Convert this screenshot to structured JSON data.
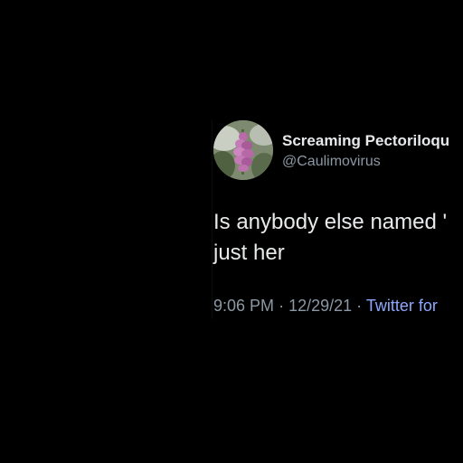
{
  "tweet": {
    "display_name": "Screaming Pectoriloqu",
    "handle": "@Caulimovirus",
    "avatar": "foxglove-flower-photo",
    "text_lines": [
      "Is anybody else named '",
      "just her"
    ],
    "time": "9:06 PM",
    "separator": "·",
    "date": "12/29/21",
    "source": "Twitter for"
  },
  "colors": {
    "background": "#000000",
    "text": "#e7e9ea",
    "secondary": "#8b98a5",
    "link": "#8ea8ff"
  }
}
